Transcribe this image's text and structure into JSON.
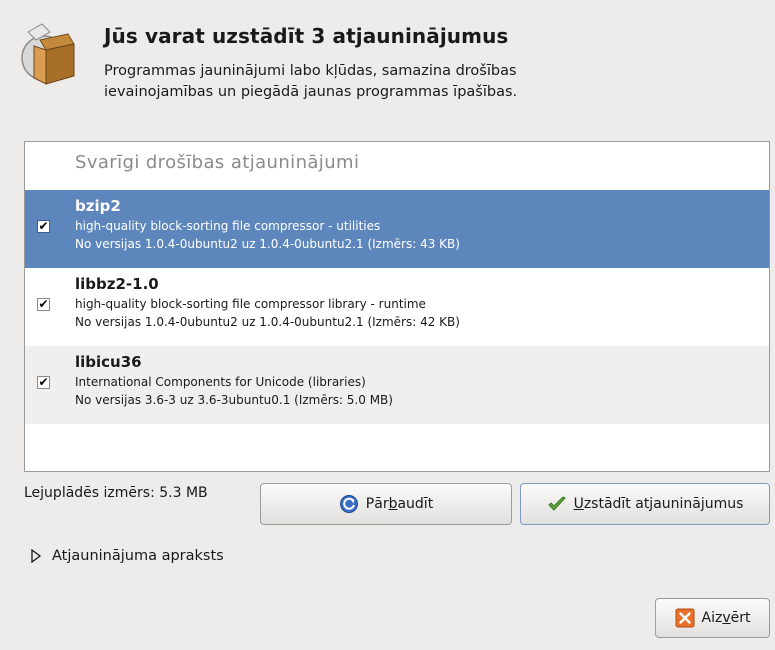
{
  "header": {
    "title": "Jūs varat uzstādīt 3 atjauninājumus",
    "description": "Programmas jauninājumi labo kļūdas, samazina drošības ievainojamības un piegādā jaunas programmas īpašības."
  },
  "updates": {
    "section_title": "Svarīgi drošības atjauninājumi",
    "items": [
      {
        "name": "bzip2",
        "description": "high-quality block-sorting file compressor - utilities",
        "version_info": "No versijas 1.0.4-0ubuntu2 uz 1.0.4-0ubuntu2.1 (Izmērs: 43 KB)",
        "checked": true,
        "check_mark": "✔"
      },
      {
        "name": "libbz2-1.0",
        "description": "high-quality block-sorting file compressor library - runtime",
        "version_info": "No versijas 1.0.4-0ubuntu2 uz 1.0.4-0ubuntu2.1 (Izmērs: 42 KB)",
        "checked": true,
        "check_mark": "✔"
      },
      {
        "name": "libicu36",
        "description": "International Components for Unicode (libraries)",
        "version_info": "No versijas 3.6-3 uz 3.6-3ubuntu0.1 (Izmērs: 5.0 MB)",
        "checked": true,
        "check_mark": "✔"
      }
    ]
  },
  "footer": {
    "download_size": "Lejuplādēs izmērs: 5.3 MB",
    "check_button": {
      "pre": "Pār",
      "mnemonic": "b",
      "post": "audīt",
      "icon": "refresh-icon"
    },
    "install_button": {
      "pre": "",
      "mnemonic": "U",
      "post": "zstādīt atjauninājumus",
      "icon": "checkmark-icon"
    },
    "description_expander": "Atjauninājuma apraksts",
    "close_button": {
      "pre": "Aiz",
      "mnemonic": "v",
      "post": "ērt",
      "icon": "close-icon"
    }
  },
  "colors": {
    "selected_row": "#5d86bd",
    "alt_row": "#f0efee",
    "window_bg": "#edeceb"
  }
}
